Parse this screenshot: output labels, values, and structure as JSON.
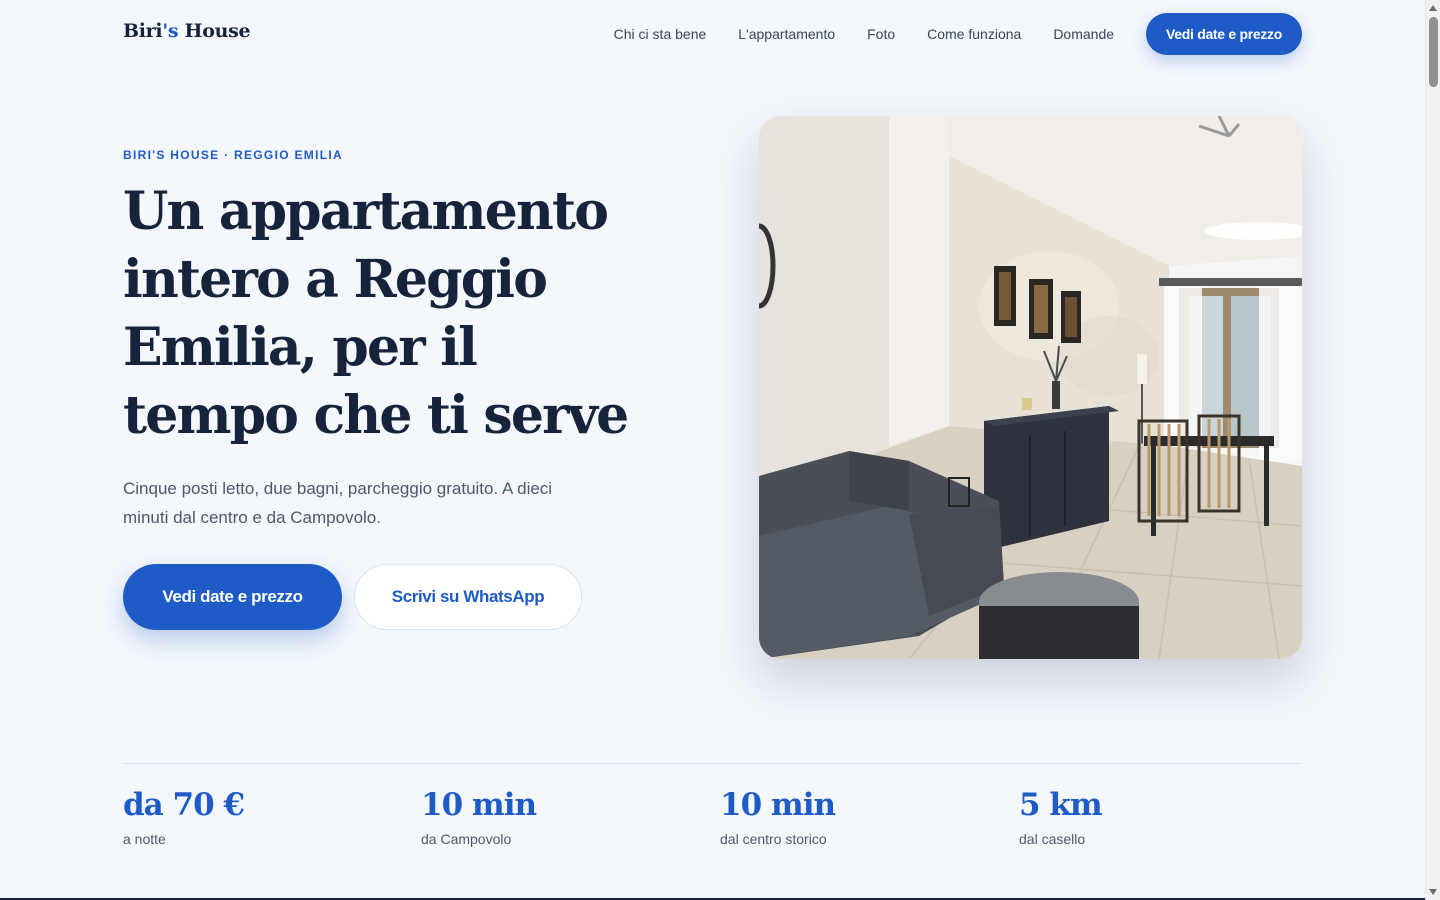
{
  "header": {
    "logo_prefix": "Biri",
    "logo_apos": "'s",
    "logo_suffix": " House",
    "nav": [
      {
        "label": "Chi ci sta bene"
      },
      {
        "label": "L'appartamento"
      },
      {
        "label": "Foto"
      },
      {
        "label": "Come funziona"
      },
      {
        "label": "Domande"
      }
    ],
    "cta_label": "Vedi date e prezzo"
  },
  "hero": {
    "eyebrow": "BIRI'S HOUSE · REGGIO EMILIA",
    "title": "Un appartamento intero a Reggio Emilia, per il tempo che ti serve",
    "subtitle": "Cinque posti letto, due bagni, parcheggio gratuito. A dieci minuti dal centro e da Campovolo.",
    "primary_button": "Vedi date e prezzo",
    "secondary_button": "Scrivi su WhatsApp"
  },
  "stats": [
    {
      "value": "da 70 €",
      "label": "a notte"
    },
    {
      "value": "10 min",
      "label": "da Campovolo"
    },
    {
      "value": "10 min",
      "label": "dal centro storico"
    },
    {
      "value": "5 km",
      "label": "dal casello"
    }
  ],
  "colors": {
    "accent": "#1e5bc6",
    "text_dark": "#16233b",
    "background": "#f4f7fc"
  }
}
